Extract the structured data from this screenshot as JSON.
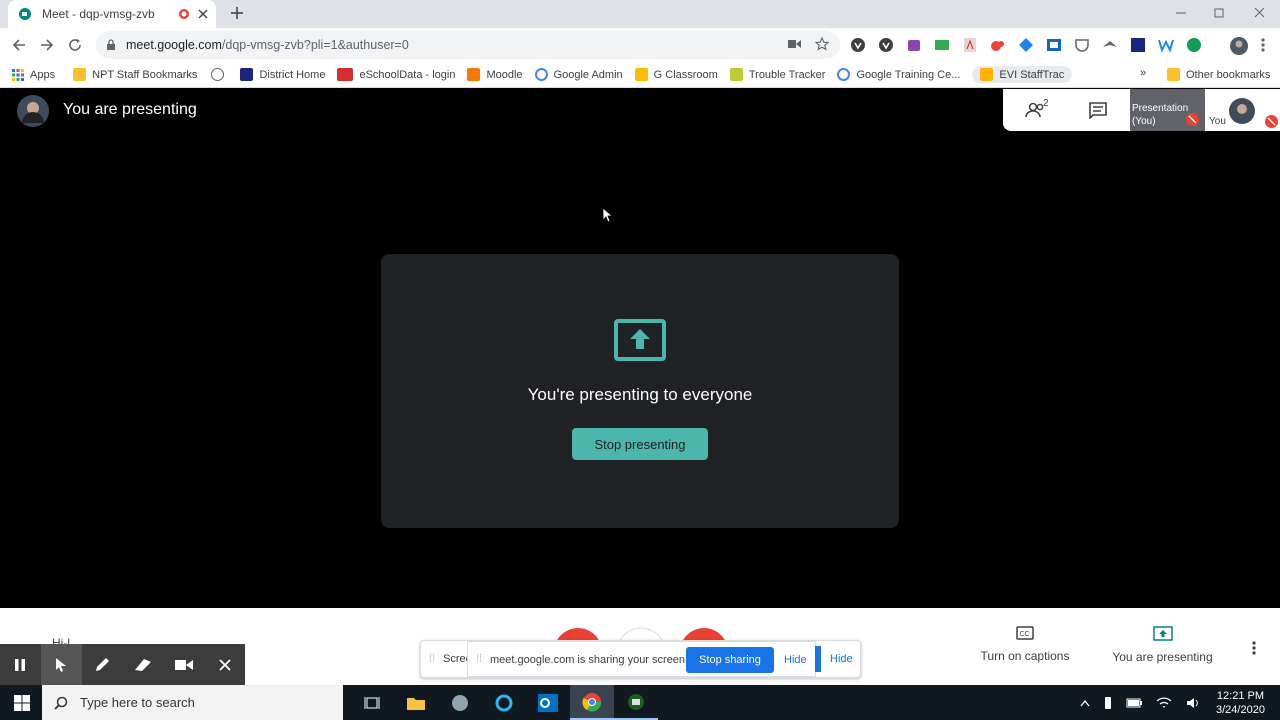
{
  "browser": {
    "tab_title": "Meet - dqp-vmsg-zvb",
    "url_host": "meet.google.com",
    "url_path": "/dqp-vmsg-zvb?pli=1&authuser=0",
    "bookmarks": [
      "Apps",
      "NPT Staff Bookmarks",
      "District Home",
      "eSchoolData - login",
      "Moodle",
      "Google Admin",
      "G Classroom",
      "Trouble Tracker",
      "Google Training Ce...",
      "EVI StaffTrac"
    ],
    "other_bookmarks": "Other bookmarks",
    "more": "»"
  },
  "meet": {
    "header_title": "You are presenting",
    "panel_message": "You're presenting to everyone",
    "stop_presenting": "Stop presenting",
    "participant_count": "2",
    "tile_presentation": "Presentation",
    "tile_presentation_you": "(You)",
    "tile_you": "You",
    "captions_label": "Turn on captions",
    "presenting_label": "You are presenting",
    "partial_text_left": "Hi-l"
  },
  "share_bar": {
    "behind_text": "Scree",
    "message": "meet.google.com is sharing your screen.",
    "stop_sharing": "Stop sharing",
    "hide": "Hide",
    "hide_back": "Hide"
  },
  "taskbar": {
    "search_placeholder": "Type here to search",
    "time": "12:21 PM",
    "date": "3/24/2020"
  },
  "colors": {
    "accent": "#4db6ac",
    "meet_red": "#ea4335",
    "share_blue": "#1a73e8",
    "panel_bg": "#202124"
  }
}
